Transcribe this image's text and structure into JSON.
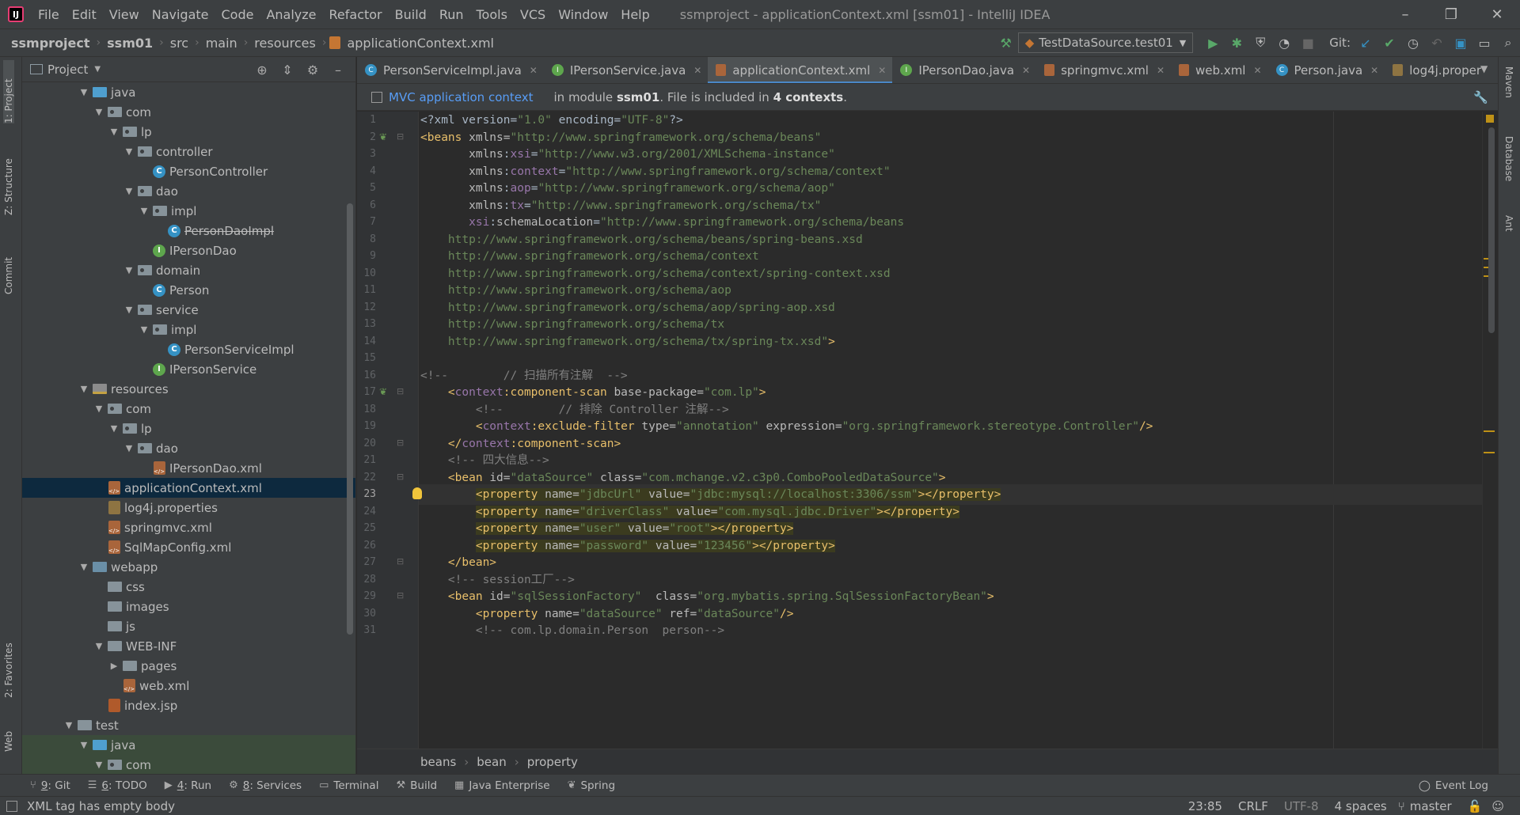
{
  "menubar": {
    "items": [
      "File",
      "Edit",
      "View",
      "Navigate",
      "Code",
      "Analyze",
      "Refactor",
      "Build",
      "Run",
      "Tools",
      "VCS",
      "Window",
      "Help"
    ],
    "window_title": "ssmproject - applicationContext.xml [ssm01] - IntelliJ IDEA"
  },
  "navbar": {
    "crumbs": [
      "ssmproject",
      "ssm01",
      "src",
      "main",
      "resources",
      "applicationContext.xml"
    ],
    "run_config": "TestDataSource.test01",
    "git_label": "Git:"
  },
  "left_stripe": {
    "tabs": [
      "1: Project",
      "Z: Structure",
      "Commit",
      "2: Favorites",
      "Web"
    ]
  },
  "right_stripe": {
    "tabs": [
      "Maven",
      "Database",
      "Ant"
    ]
  },
  "project": {
    "title": "Project",
    "tree": [
      {
        "label": "java",
        "depth": 4,
        "kind": "src",
        "arrow": "open"
      },
      {
        "label": "com",
        "depth": 5,
        "kind": "pkg",
        "arrow": "open"
      },
      {
        "label": "lp",
        "depth": 6,
        "kind": "pkg",
        "arrow": "open"
      },
      {
        "label": "controller",
        "depth": 7,
        "kind": "pkg",
        "arrow": "open"
      },
      {
        "label": "PersonController",
        "depth": 8,
        "kind": "class",
        "arrow": "none"
      },
      {
        "label": "dao",
        "depth": 7,
        "kind": "pkg",
        "arrow": "open"
      },
      {
        "label": "impl",
        "depth": 8,
        "kind": "pkg",
        "arrow": "open"
      },
      {
        "label": "PersonDaoImpl",
        "depth": 9,
        "kind": "class",
        "arrow": "none",
        "strike": true
      },
      {
        "label": "IPersonDao",
        "depth": 8,
        "kind": "iface",
        "arrow": "none"
      },
      {
        "label": "domain",
        "depth": 7,
        "kind": "pkg",
        "arrow": "open"
      },
      {
        "label": "Person",
        "depth": 8,
        "kind": "class",
        "arrow": "none"
      },
      {
        "label": "service",
        "depth": 7,
        "kind": "pkg",
        "arrow": "open"
      },
      {
        "label": "impl",
        "depth": 8,
        "kind": "pkg",
        "arrow": "open"
      },
      {
        "label": "PersonServiceImpl",
        "depth": 9,
        "kind": "class",
        "arrow": "none"
      },
      {
        "label": "IPersonService",
        "depth": 8,
        "kind": "iface",
        "arrow": "none"
      },
      {
        "label": "resources",
        "depth": 4,
        "kind": "res",
        "arrow": "open"
      },
      {
        "label": "com",
        "depth": 5,
        "kind": "pkg",
        "arrow": "open"
      },
      {
        "label": "lp",
        "depth": 6,
        "kind": "pkg",
        "arrow": "open"
      },
      {
        "label": "dao",
        "depth": 7,
        "kind": "pkg",
        "arrow": "open"
      },
      {
        "label": "IPersonDao.xml",
        "depth": 8,
        "kind": "xml",
        "arrow": "none"
      },
      {
        "label": "applicationContext.xml",
        "depth": 5,
        "kind": "xml",
        "arrow": "none",
        "selected": true
      },
      {
        "label": "log4j.properties",
        "depth": 5,
        "kind": "props",
        "arrow": "none"
      },
      {
        "label": "springmvc.xml",
        "depth": 5,
        "kind": "xml",
        "arrow": "none"
      },
      {
        "label": "SqlMapConfig.xml",
        "depth": 5,
        "kind": "xml",
        "arrow": "none"
      },
      {
        "label": "webapp",
        "depth": 4,
        "kind": "web",
        "arrow": "open"
      },
      {
        "label": "css",
        "depth": 5,
        "kind": "folder",
        "arrow": "none"
      },
      {
        "label": "images",
        "depth": 5,
        "kind": "folder",
        "arrow": "none"
      },
      {
        "label": "js",
        "depth": 5,
        "kind": "folder",
        "arrow": "none"
      },
      {
        "label": "WEB-INF",
        "depth": 5,
        "kind": "folder",
        "arrow": "open"
      },
      {
        "label": "pages",
        "depth": 6,
        "kind": "folder",
        "arrow": "closed"
      },
      {
        "label": "web.xml",
        "depth": 6,
        "kind": "xml",
        "arrow": "none"
      },
      {
        "label": "index.jsp",
        "depth": 5,
        "kind": "jsp",
        "arrow": "none"
      },
      {
        "label": "test",
        "depth": 3,
        "kind": "folder",
        "arrow": "open"
      },
      {
        "label": "java",
        "depth": 4,
        "kind": "src",
        "arrow": "open",
        "hl": true
      },
      {
        "label": "com",
        "depth": 5,
        "kind": "pkg",
        "arrow": "open",
        "hl": true
      }
    ]
  },
  "tabs": [
    {
      "label": "PersonServiceImpl.java",
      "icon": "class"
    },
    {
      "label": "IPersonService.java",
      "icon": "iface"
    },
    {
      "label": "applicationContext.xml",
      "icon": "xml",
      "active": true
    },
    {
      "label": "IPersonDao.java",
      "icon": "iface"
    },
    {
      "label": "springmvc.xml",
      "icon": "xml"
    },
    {
      "label": "web.xml",
      "icon": "xml"
    },
    {
      "label": "Person.java",
      "icon": "class"
    },
    {
      "label": "log4j.proper",
      "icon": "props"
    }
  ],
  "infobar": {
    "link": "MVC application context",
    "pre": "in module",
    "module": "ssm01",
    "mid": ". File is included in",
    "count": "4 contexts",
    "post": "."
  },
  "code": {
    "current_line": 23,
    "lines": [
      [
        [
          "t-plain",
          "<?xml version="
        ],
        [
          "t-val",
          "\"1.0\""
        ],
        [
          "t-plain",
          " encoding="
        ],
        [
          "t-val",
          "\"UTF-8\""
        ],
        [
          "t-plain",
          "?>"
        ]
      ],
      [
        [
          "t-tag",
          "<beans "
        ],
        [
          "t-attr",
          "xmlns="
        ],
        [
          "t-val",
          "\"http://www.springframework.org/schema/beans\""
        ]
      ],
      [
        [
          "t-plain",
          "       "
        ],
        [
          "t-attr",
          "xmlns"
        ],
        [
          "t-plain",
          ":"
        ],
        [
          "t-ns",
          "xsi"
        ],
        [
          "t-plain",
          "="
        ],
        [
          "t-val",
          "\"http://www.w3.org/2001/XMLSchema-instance\""
        ]
      ],
      [
        [
          "t-plain",
          "       "
        ],
        [
          "t-attr",
          "xmlns"
        ],
        [
          "t-plain",
          ":"
        ],
        [
          "t-ns",
          "context"
        ],
        [
          "t-plain",
          "="
        ],
        [
          "t-val",
          "\"http://www.springframework.org/schema/context\""
        ]
      ],
      [
        [
          "t-plain",
          "       "
        ],
        [
          "t-attr",
          "xmlns"
        ],
        [
          "t-plain",
          ":"
        ],
        [
          "t-ns",
          "aop"
        ],
        [
          "t-plain",
          "="
        ],
        [
          "t-val",
          "\"http://www.springframework.org/schema/aop\""
        ]
      ],
      [
        [
          "t-plain",
          "       "
        ],
        [
          "t-attr",
          "xmlns"
        ],
        [
          "t-plain",
          ":"
        ],
        [
          "t-ns",
          "tx"
        ],
        [
          "t-plain",
          "="
        ],
        [
          "t-val",
          "\"http://www.springframework.org/schema/tx\""
        ]
      ],
      [
        [
          "t-plain",
          "       "
        ],
        [
          "t-ns",
          "xsi"
        ],
        [
          "t-plain",
          ":"
        ],
        [
          "t-attr",
          "schemaLocation"
        ],
        [
          "t-plain",
          "="
        ],
        [
          "t-val",
          "\"http://www.springframework.org/schema/beans"
        ]
      ],
      [
        [
          "t-val",
          "    http://www.springframework.org/schema/beans/spring-beans.xsd"
        ]
      ],
      [
        [
          "t-val",
          "    http://www.springframework.org/schema/context"
        ]
      ],
      [
        [
          "t-val",
          "    http://www.springframework.org/schema/context/spring-context.xsd"
        ]
      ],
      [
        [
          "t-val",
          "    http://www.springframework.org/schema/aop"
        ]
      ],
      [
        [
          "t-val",
          "    http://www.springframework.org/schema/aop/spring-aop.xsd"
        ]
      ],
      [
        [
          "t-val",
          "    http://www.springframework.org/schema/tx"
        ]
      ],
      [
        [
          "t-val",
          "    http://www.springframework.org/schema/tx/spring-tx.xsd\""
        ],
        [
          "t-tag",
          ">"
        ]
      ],
      [
        [
          "t-plain",
          ""
        ]
      ],
      [
        [
          "t-comment",
          "<!--        // 扫描所有注解  -->"
        ]
      ],
      [
        [
          "t-plain",
          "    "
        ],
        [
          "t-tag",
          "<"
        ],
        [
          "t-ns",
          "context"
        ],
        [
          "t-tag",
          ":component-scan "
        ],
        [
          "t-attr",
          "base-package="
        ],
        [
          "t-val",
          "\"com.lp\""
        ],
        [
          "t-tag",
          ">"
        ]
      ],
      [
        [
          "t-comment",
          "        <!--        // 排除 Controller 注解-->"
        ]
      ],
      [
        [
          "t-plain",
          "        "
        ],
        [
          "t-tag",
          "<"
        ],
        [
          "t-ns",
          "context"
        ],
        [
          "t-tag",
          ":exclude-filter "
        ],
        [
          "t-attr",
          "type="
        ],
        [
          "t-val",
          "\"annotation\""
        ],
        [
          "t-plain",
          " "
        ],
        [
          "t-attr",
          "expression="
        ],
        [
          "t-val",
          "\"org.springframework.stereotype.Controller\""
        ],
        [
          "t-tag",
          "/>"
        ]
      ],
      [
        [
          "t-plain",
          "    "
        ],
        [
          "t-tag",
          "</"
        ],
        [
          "t-ns",
          "context"
        ],
        [
          "t-tag",
          ":component-scan>"
        ]
      ],
      [
        [
          "t-comment",
          "    <!-- 四大信息-->"
        ]
      ],
      [
        [
          "t-plain",
          "    "
        ],
        [
          "t-tag",
          "<bean "
        ],
        [
          "t-attr",
          "id="
        ],
        [
          "t-val",
          "\"dataSource\""
        ],
        [
          "t-plain",
          " "
        ],
        [
          "t-attr",
          "class="
        ],
        [
          "t-val",
          "\"com.mchange.v2.c3p0.ComboPooledDataSource\""
        ],
        [
          "t-tag",
          ">"
        ]
      ],
      [
        [
          "t-plain",
          "        "
        ],
        [
          "t-tag sel-hl",
          "<property "
        ],
        [
          "t-attr sel-hl",
          "name="
        ],
        [
          "t-val sel-hl",
          "\"jdbcUrl\""
        ],
        [
          "t-plain sel-hl",
          " "
        ],
        [
          "t-attr sel-hl",
          "value="
        ],
        [
          "t-val sel-hl",
          "\"jdbc:mysql://localhost:3306/ssm\""
        ],
        [
          "t-tag sel-hl",
          "></property>"
        ]
      ],
      [
        [
          "t-plain",
          "        "
        ],
        [
          "t-tag sel-hl",
          "<property "
        ],
        [
          "t-attr sel-hl",
          "name="
        ],
        [
          "t-val sel-hl",
          "\"driverClass\""
        ],
        [
          "t-plain sel-hl",
          " "
        ],
        [
          "t-attr sel-hl",
          "value="
        ],
        [
          "t-val sel-hl",
          "\"com.mysql.jdbc.Driver\""
        ],
        [
          "t-tag sel-hl",
          "></property>"
        ]
      ],
      [
        [
          "t-plain",
          "        "
        ],
        [
          "t-tag sel-hl",
          "<property "
        ],
        [
          "t-attr sel-hl",
          "name="
        ],
        [
          "t-val sel-hl",
          "\"user\""
        ],
        [
          "t-plain sel-hl",
          " "
        ],
        [
          "t-attr sel-hl",
          "value="
        ],
        [
          "t-val sel-hl",
          "\"root\""
        ],
        [
          "t-tag sel-hl",
          "></property>"
        ]
      ],
      [
        [
          "t-plain",
          "        "
        ],
        [
          "t-tag sel-hl",
          "<property "
        ],
        [
          "t-attr sel-hl",
          "name="
        ],
        [
          "t-val sel-hl",
          "\"password\""
        ],
        [
          "t-plain sel-hl",
          " "
        ],
        [
          "t-attr sel-hl",
          "value="
        ],
        [
          "t-val sel-hl",
          "\"123456\""
        ],
        [
          "t-tag sel-hl",
          "></property>"
        ]
      ],
      [
        [
          "t-plain",
          "    "
        ],
        [
          "t-tag",
          "</bean>"
        ]
      ],
      [
        [
          "t-comment",
          "    <!-- session工厂-->"
        ]
      ],
      [
        [
          "t-plain",
          "    "
        ],
        [
          "t-tag",
          "<bean "
        ],
        [
          "t-attr",
          "id="
        ],
        [
          "t-val",
          "\"sqlSessionFactory\""
        ],
        [
          "t-plain",
          "  "
        ],
        [
          "t-attr",
          "class="
        ],
        [
          "t-val",
          "\"org.mybatis.spring.SqlSessionFactoryBean\""
        ],
        [
          "t-tag",
          ">"
        ]
      ],
      [
        [
          "t-plain",
          "        "
        ],
        [
          "t-tag",
          "<property "
        ],
        [
          "t-attr",
          "name="
        ],
        [
          "t-val",
          "\"dataSource\""
        ],
        [
          "t-plain",
          " "
        ],
        [
          "t-attr",
          "ref="
        ],
        [
          "t-val",
          "\"dataSource\""
        ],
        [
          "t-tag",
          "/>"
        ]
      ],
      [
        [
          "t-comment",
          "        <!-- com.lp.domain.Person  person-->"
        ]
      ]
    ]
  },
  "editor_crumbs": [
    "beans",
    "bean",
    "property"
  ],
  "toolwindows": [
    {
      "num": "9",
      "label": ": Git",
      "icon": "git-icon",
      "glyph": "⑂"
    },
    {
      "num": "6",
      "label": ": TODO",
      "icon": "todo-icon",
      "glyph": "☰"
    },
    {
      "num": "4",
      "label": ": Run",
      "icon": "run-icon",
      "glyph": "▶"
    },
    {
      "num": "8",
      "label": ": Services",
      "icon": "services-icon",
      "glyph": "⚙"
    },
    {
      "num": "",
      "label": "Terminal",
      "icon": "terminal-icon",
      "glyph": "▭"
    },
    {
      "num": "",
      "label": "Build",
      "icon": "build-icon",
      "glyph": "⚒"
    },
    {
      "num": "",
      "label": "Java Enterprise",
      "icon": "java-enterprise-icon",
      "glyph": "▦"
    },
    {
      "num": "",
      "label": "Spring",
      "icon": "spring-icon",
      "glyph": "❦"
    }
  ],
  "event_log": "Event Log",
  "status": {
    "message": "XML tag has empty body",
    "position": "23:85",
    "line_sep": "CRLF",
    "encoding": "UTF-8",
    "indent": "4 spaces",
    "branch": "master"
  }
}
